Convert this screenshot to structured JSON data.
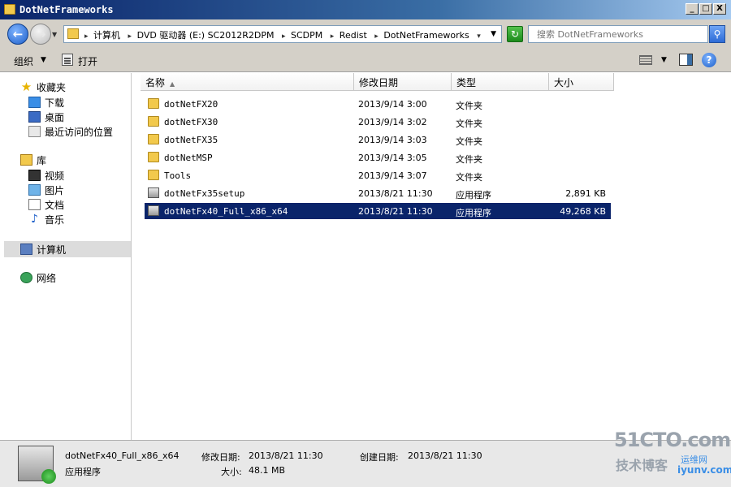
{
  "window": {
    "title": "DotNetFrameworks",
    "buttons": [
      "_",
      "□",
      "X"
    ]
  },
  "address": {
    "crumbs": [
      "计算机",
      "DVD 驱动器 (E:) SC2012R2DPM",
      "SCDPM",
      "Redist",
      "DotNetFrameworks"
    ],
    "search_placeholder": "搜索 DotNetFrameworks"
  },
  "toolbar": {
    "organize_label": "组织",
    "open_label": "打开"
  },
  "navpane": {
    "favorites": {
      "label": "收藏夹",
      "items": [
        "下载",
        "桌面",
        "最近访问的位置"
      ]
    },
    "libraries": {
      "label": "库",
      "items": [
        "视频",
        "图片",
        "文档",
        "音乐"
      ]
    },
    "computer": "计算机",
    "network": "网络"
  },
  "columns": {
    "name": "名称",
    "date": "修改日期",
    "type": "类型",
    "size": "大小"
  },
  "files": [
    {
      "name": "dotNetFX20",
      "date": "2013/9/14 3:00",
      "type": "文件夹",
      "size": "",
      "kind": "folder"
    },
    {
      "name": "dotNetFX30",
      "date": "2013/9/14 3:02",
      "type": "文件夹",
      "size": "",
      "kind": "folder"
    },
    {
      "name": "dotNetFX35",
      "date": "2013/9/14 3:03",
      "type": "文件夹",
      "size": "",
      "kind": "folder"
    },
    {
      "name": "dotNetMSP",
      "date": "2013/9/14 3:05",
      "type": "文件夹",
      "size": "",
      "kind": "folder"
    },
    {
      "name": "Tools",
      "date": "2013/9/14 3:07",
      "type": "文件夹",
      "size": "",
      "kind": "folder"
    },
    {
      "name": "dotNetFx35setup",
      "date": "2013/8/21 11:30",
      "type": "应用程序",
      "size": "2,891 KB",
      "kind": "exe"
    },
    {
      "name": "dotNetFx40_Full_x86_x64",
      "date": "2013/8/21 11:30",
      "type": "应用程序",
      "size": "49,268 KB",
      "kind": "exe",
      "selected": true
    }
  ],
  "details": {
    "name": "dotNetFx40_Full_x86_x64",
    "modified_label": "修改日期:",
    "modified": "2013/8/21 11:30",
    "created_label": "创建日期:",
    "created": "2013/8/21 11:30",
    "type": "应用程序",
    "size_label": "大小:",
    "size": "48.1 MB"
  },
  "watermark": {
    "line1": "51CTO.com",
    "line2": "技术博客",
    "line3": "运维网",
    "line4": "iyunv.com"
  }
}
